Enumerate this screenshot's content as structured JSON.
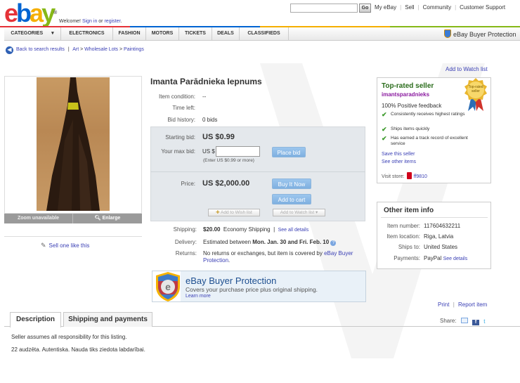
{
  "header": {
    "logo": {
      "e": "e",
      "b": "b",
      "a": "a",
      "y": "y",
      "reg": "®"
    },
    "welcome_prefix": "Welcome! ",
    "sign_in": "Sign in",
    "welcome_or": " or ",
    "register": "register",
    "welcome_suffix": ".",
    "go_label": "Go",
    "links": [
      "My eBay",
      "Sell",
      "Community",
      "Customer Support"
    ]
  },
  "nav": {
    "items": [
      "CATEGORIES",
      "ELECTRONICS",
      "FASHION",
      "MOTORS",
      "TICKETS",
      "DEALS",
      "CLASSIFIEDS"
    ],
    "buyer_protection": "eBay Buyer Protection"
  },
  "breadcrumb": {
    "back": "Back to search results",
    "sep": "|",
    "art": "Art",
    "arrow1": ">",
    "wholesale": "Wholesale Lots",
    "arrow2": ">",
    "paintings": "Paintings"
  },
  "watch_top": "Add to Watch list",
  "image": {
    "zoom": "Zoom unavailable",
    "enlarge": "Enlarge",
    "sell_one": "Sell one like this"
  },
  "item": {
    "title": "Imanta Parādnieka Iepnums",
    "condition_label": "Item condition:",
    "condition_value": "--",
    "time_label": "Time left:",
    "history_label": "Bid history:",
    "history_value": "0 bids",
    "starting_label": "Starting bid:",
    "starting_value": "US $0.99",
    "maxbid_label": "Your max bid:",
    "maxbid_prefix": "US $",
    "maxbid_hint": "(Enter US $0.99 or more)",
    "place_bid": "Place bid",
    "price_label": "Price:",
    "price_value": "US $2,000.00",
    "buy_now": "Buy It Now",
    "add_cart": "Add to cart",
    "add_wish": "Add to Wish list",
    "add_watch": "Add to Watch list"
  },
  "shipping": {
    "ship_label": "Shipping:",
    "ship_cost": "$20.00",
    "ship_type": "Economy Shipping",
    "ship_sep": "|",
    "ship_details": "See all details",
    "delivery_label": "Delivery:",
    "delivery_prefix": "Estimated between ",
    "delivery_dates": "Mon. Jan. 30 and Fri. Feb. 10",
    "returns_label": "Returns:",
    "returns_text": "No returns or exchanges, but item is covered by",
    "returns_link": "eBay Buyer Protection",
    "returns_end": "."
  },
  "bp_banner": {
    "title": "eBay Buyer Protection",
    "sub": "Covers your purchase price plus original shipping.",
    "more": "Learn more"
  },
  "seller": {
    "title": "Top-rated seller",
    "name": "imantsparadnieks",
    "medal": "Top-rated seller",
    "feedback": "100% Positive feedback",
    "points": [
      "Consistently receives highest ratings",
      "Ships items quickly",
      "Has earned a track record of excellent service"
    ],
    "save": "Save this seller",
    "other": "See other items",
    "visit": "Visit store:",
    "store": "ff9810"
  },
  "other_info": {
    "title": "Other item info",
    "rows": [
      {
        "label": "Item number:",
        "value": "117604632211"
      },
      {
        "label": "Item location:",
        "value": "Riga, Latvia"
      },
      {
        "label": "Ships to:",
        "value": "United States"
      },
      {
        "label": "Payments:",
        "value": "PayPal"
      }
    ],
    "payments_link": "See details"
  },
  "print_links": {
    "print": "Print",
    "sep": "|",
    "report": "Report item"
  },
  "tabs": {
    "description": "Description",
    "shipping": "Shipping and payments"
  },
  "share": "Share:",
  "description": {
    "line1": "Seller assumes all responsibility for this listing.",
    "line2": "22 audzēta. Autentiska. Nauda tiks ziedota labdarībai."
  },
  "colors": {
    "accent": "#3b40b5",
    "green": "#2a6c1b",
    "purple": "#8b1ba0",
    "panel": "#e4e8ec"
  }
}
